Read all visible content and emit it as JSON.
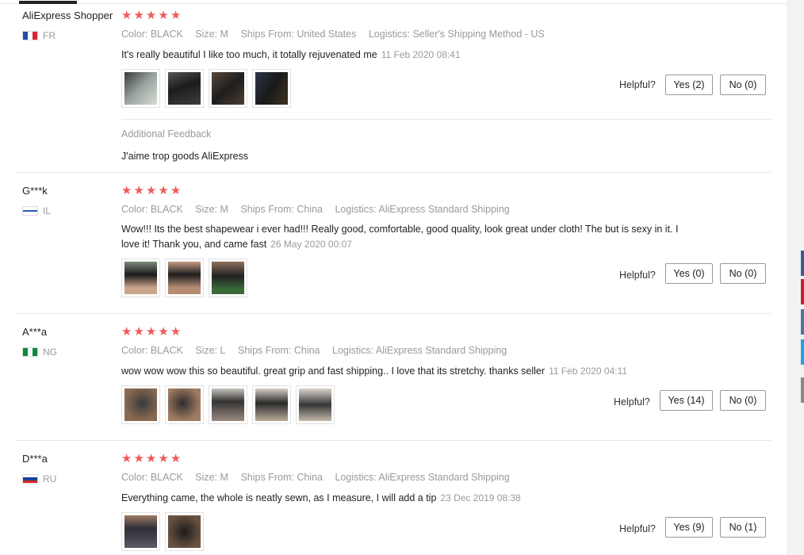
{
  "labels": {
    "helpful": "Helpful?",
    "additional_feedback": "Additional Feedback",
    "star": "★"
  },
  "reviews": [
    {
      "user": "AliExpress Shopper",
      "country": "FR",
      "flag_colors": [
        "#1f4fa8",
        "#ffffff",
        "#d6262f"
      ],
      "rating": 5,
      "color": "Color: BLACK",
      "size": "Size: M",
      "ships_from": "Ships From: United States",
      "logistics": "Logistics: Seller's Shipping Method - US",
      "text": "It's really beautiful I like too much, it totally rejuvenated me",
      "date": "11 Feb 2020 08:41",
      "photo_count": 4,
      "yes_label": "Yes (2)",
      "no_label": "No (0)",
      "additional_feedback_text": "J'aime trop goods AliExpress"
    },
    {
      "user": "G***k",
      "country": "IL",
      "flag_colors": [
        "#ffffff",
        "#2a5cb8",
        "#ffffff"
      ],
      "rating": 5,
      "color": "Color: BLACK",
      "size": "Size: M",
      "ships_from": "Ships From: China",
      "logistics": "Logistics: AliExpress Standard Shipping",
      "text": "Wow!!! Its the best shapewear i ever had!!! Really good, comfortable, good quality, look great under cloth! The but is sexy in it. I love it! Thank you, and came fast",
      "date": "26 May 2020 00:07",
      "photo_count": 3,
      "yes_label": "Yes (0)",
      "no_label": "No (0)"
    },
    {
      "user": "A***a",
      "country": "NG",
      "flag_colors": [
        "#0a8a3c",
        "#ffffff",
        "#0a8a3c"
      ],
      "rating": 5,
      "color": "Color: BLACK",
      "size": "Size: L",
      "ships_from": "Ships From: China",
      "logistics": "Logistics: AliExpress Standard Shipping",
      "text": "wow wow wow this so beautiful. great grip and fast shipping.. I love that its stretchy. thanks seller",
      "date": "11 Feb 2020 04:11",
      "photo_count": 5,
      "yes_label": "Yes (14)",
      "no_label": "No (0)"
    },
    {
      "user": "D***a",
      "country": "RU",
      "flag_colors": [
        "#ffffff",
        "#1c3f9c",
        "#d52b1e"
      ],
      "rating": 5,
      "color": "Color: BLACK",
      "size": "Size: M",
      "ships_from": "Ships From: China",
      "logistics": "Logistics: AliExpress Standard Shipping",
      "text": "Everything came, the whole is neatly sewn, as I measure, I will add a tip",
      "date": "23 Dec 2019 08:38",
      "photo_count": 2,
      "yes_label": "Yes (9)",
      "no_label": "No (1)"
    }
  ],
  "side_share_colors": [
    "#3b5998",
    "#cb2027",
    "#4a76a8",
    "#1da1f2",
    "#888888"
  ]
}
